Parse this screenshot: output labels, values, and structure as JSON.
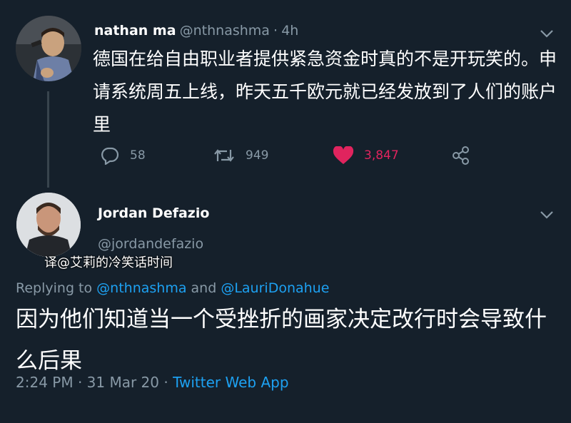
{
  "tweet1": {
    "display_name": "nathan ma",
    "handle": "@nthnashma",
    "separator": "·",
    "time": "4h",
    "text": "德国在给自由职业者提供紧急资金时真的不是开玩笑的。申请系统周五上线，昨天五千欧元就已经发放到了人们的账户里",
    "reply_count": "58",
    "retweet_count": "949",
    "like_count": "3,847",
    "like_color": "#e0245e"
  },
  "tweet2": {
    "display_name": "Jordan Defazio",
    "handle": "@jordandefazio",
    "overlay_note": "译@艾莉的冷笑话时间",
    "replying_prefix": "Replying to",
    "replying_to_1": "@nthnashma",
    "replying_and": "and",
    "replying_to_2": "@LauriDonahue",
    "text": "因为他们知道当一个受挫折的画家决定改行时会导致什么后果",
    "timestamp": "2:24 PM · 31 Mar 20 ·",
    "source": "Twitter Web App"
  },
  "colors": {
    "background": "#15202b",
    "link": "#1da1f2",
    "muted": "#8899a6"
  }
}
